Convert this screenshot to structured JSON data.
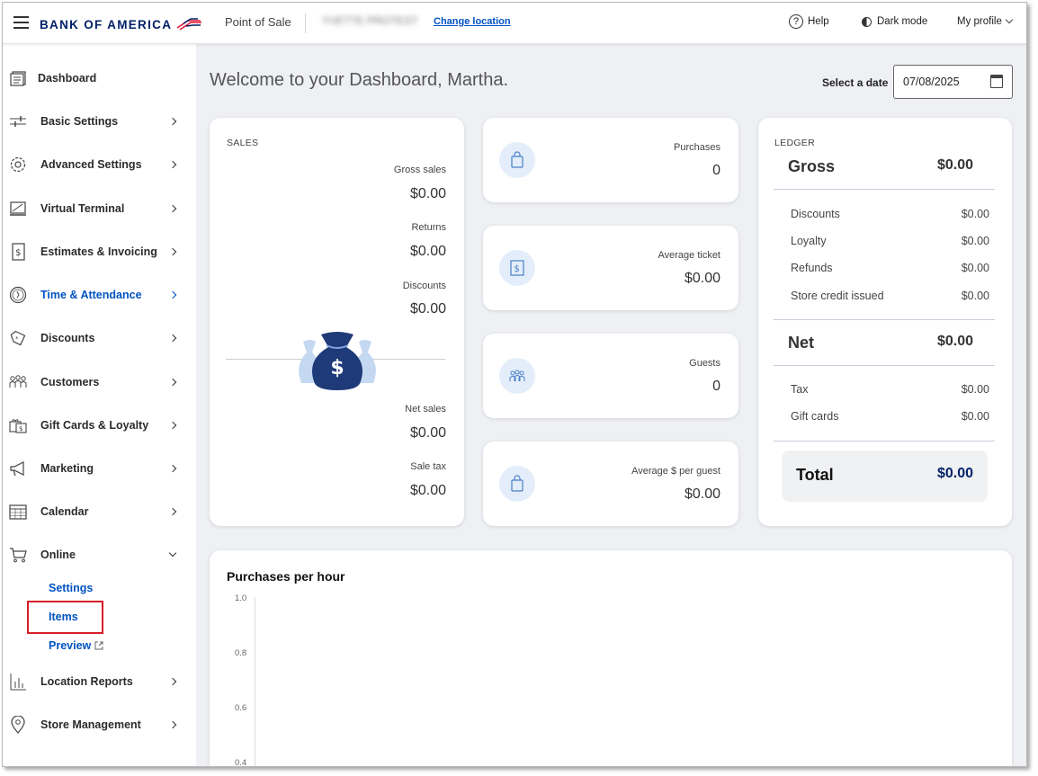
{
  "header": {
    "brand": "BANK OF AMERICA",
    "app_name": "Point of Sale",
    "location_name": "YVETTE PROTEST",
    "change_location": "Change location",
    "help": "Help",
    "dark_mode": "Dark mode",
    "profile": "My profile"
  },
  "sidebar": {
    "items": [
      {
        "label": "Dashboard",
        "icon": "dashboard-icon"
      },
      {
        "label": "Basic Settings",
        "icon": "sliders-icon"
      },
      {
        "label": "Advanced Settings",
        "icon": "gear-icon"
      },
      {
        "label": "Virtual Terminal",
        "icon": "terminal-icon"
      },
      {
        "label": "Estimates & Invoicing",
        "icon": "invoice-icon"
      },
      {
        "label": "Time & Attendance",
        "icon": "clock-icon"
      },
      {
        "label": "Discounts",
        "icon": "tag-icon"
      },
      {
        "label": "Customers",
        "icon": "customers-icon"
      },
      {
        "label": "Gift Cards & Loyalty",
        "icon": "gift-card-icon"
      },
      {
        "label": "Marketing",
        "icon": "megaphone-icon"
      },
      {
        "label": "Calendar",
        "icon": "calendar-icon"
      },
      {
        "label": "Online",
        "icon": "cart-icon"
      },
      {
        "label": "Location Reports",
        "icon": "bar-chart-icon"
      },
      {
        "label": "Store Management",
        "icon": "location-pin-icon"
      }
    ],
    "online_sub": [
      "Settings",
      "Items",
      "Preview"
    ]
  },
  "main": {
    "welcome": "Welcome to your Dashboard, Martha.",
    "date_label": "Select a date",
    "date_value": "07/08/2025"
  },
  "sales": {
    "title": "SALES",
    "gross_label": "Gross sales",
    "gross_value": "$0.00",
    "returns_label": "Returns",
    "returns_value": "$0.00",
    "discounts_label": "Discounts",
    "discounts_value": "$0.00",
    "net_label": "Net sales",
    "net_value": "$0.00",
    "tax_label": "Sale tax",
    "tax_value": "$0.00"
  },
  "metrics": [
    {
      "label": "Purchases",
      "value": "0",
      "icon": "shopping-bag-icon"
    },
    {
      "label": "Average ticket",
      "value": "$0.00",
      "icon": "receipt-icon"
    },
    {
      "label": "Guests",
      "value": "0",
      "icon": "guests-icon"
    },
    {
      "label": "Average $ per guest",
      "value": "$0.00",
      "icon": "shopping-bag-icon"
    }
  ],
  "ledger": {
    "title": "LEDGER",
    "gross_label": "Gross",
    "gross_value": "$0.00",
    "rows1": [
      {
        "label": "Discounts",
        "value": "$0.00"
      },
      {
        "label": "Loyalty",
        "value": "$0.00"
      },
      {
        "label": "Refunds",
        "value": "$0.00"
      },
      {
        "label": "Store credit issued",
        "value": "$0.00"
      }
    ],
    "net_label": "Net",
    "net_value": "$0.00",
    "rows2": [
      {
        "label": "Tax",
        "value": "$0.00"
      },
      {
        "label": "Gift cards",
        "value": "$0.00"
      }
    ],
    "total_label": "Total",
    "total_value": "$0.00"
  },
  "chart_data": {
    "type": "bar",
    "title": "Purchases per hour",
    "y_ticks": [
      "1.0",
      "0.8",
      "0.6",
      "0.4"
    ],
    "ylim": [
      0,
      1.0
    ],
    "series": []
  },
  "colors": {
    "brand_navy": "#012169",
    "brand_red": "#e31837",
    "link_blue": "#0053c2",
    "highlight_red": "#d71e28"
  }
}
